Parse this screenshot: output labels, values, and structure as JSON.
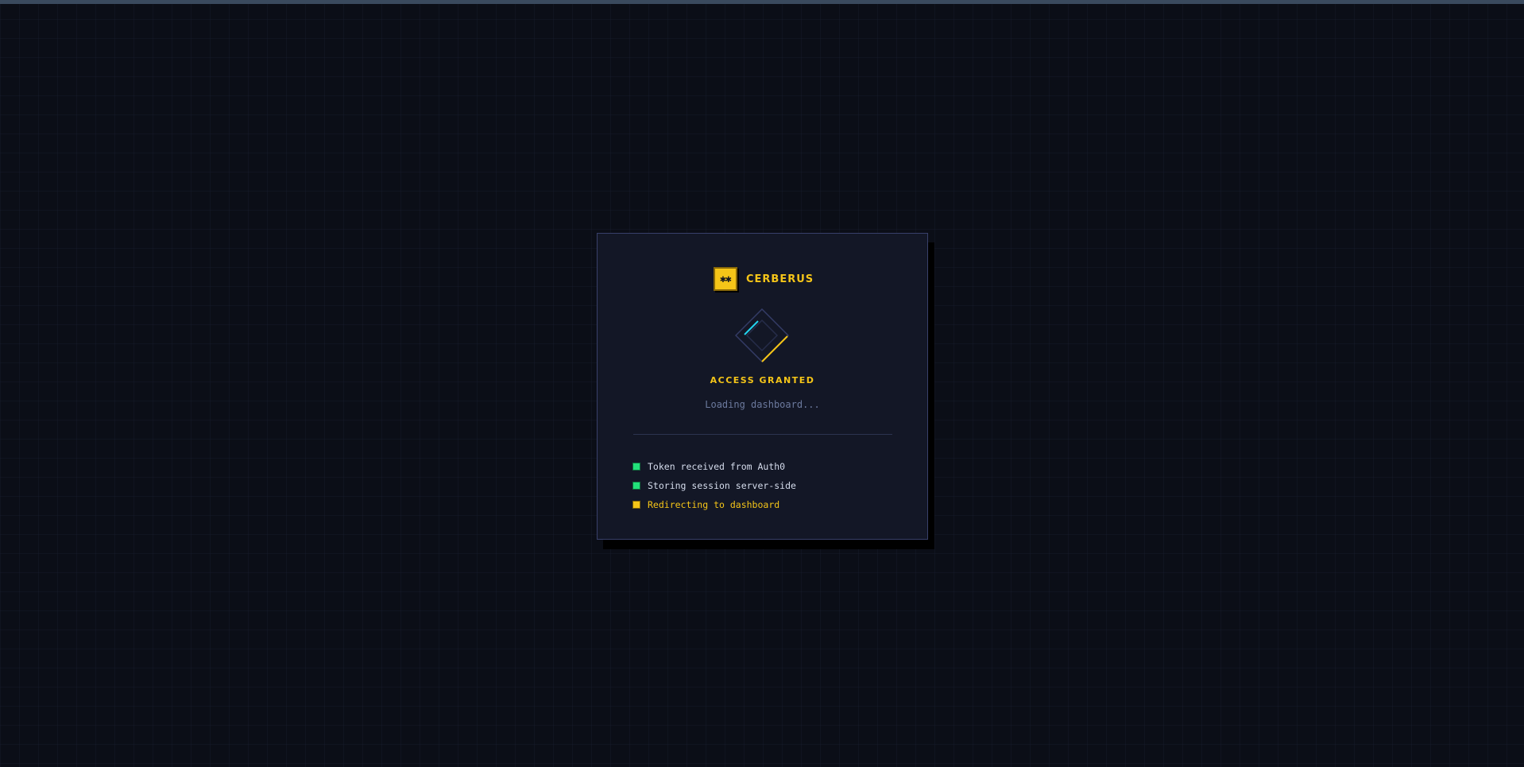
{
  "brand": {
    "logo_glyph": "✱✱",
    "name": "CERBERUS",
    "logo_icon": "cerberus-logo-icon"
  },
  "loader": {
    "icon": "diamond-spinner-icon",
    "colors": {
      "accent_cyan": "#22d3ee",
      "accent_gold": "#f5c518",
      "frame": "#38406a"
    }
  },
  "status": {
    "title": "ACCESS GRANTED",
    "subtitle": "Loading dashboard..."
  },
  "steps": [
    {
      "label": "Token received from Auth0",
      "state": "done"
    },
    {
      "label": "Storing session server-side",
      "state": "done"
    },
    {
      "label": "Redirecting to dashboard",
      "state": "active"
    }
  ],
  "colors": {
    "background": "#0b0e17",
    "card": "#131726",
    "gold": "#f5c518",
    "success": "#22e07a",
    "muted_text": "#6c7a9e"
  }
}
